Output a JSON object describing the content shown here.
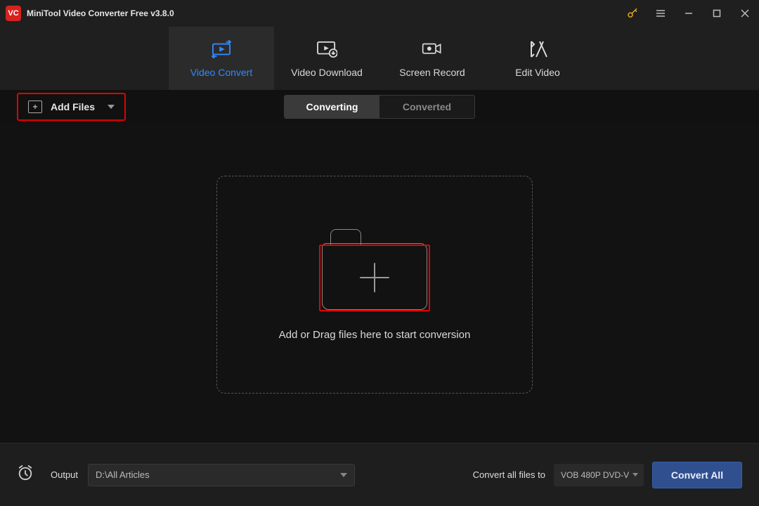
{
  "titlebar": {
    "app_abbrev": "VC",
    "title": "MiniTool Video Converter Free v3.8.0"
  },
  "tabs": {
    "convert": "Video Convert",
    "download": "Video Download",
    "record": "Screen Record",
    "edit": "Edit Video"
  },
  "toolbar": {
    "add_files": "Add Files",
    "seg_converting": "Converting",
    "seg_converted": "Converted"
  },
  "dropzone": {
    "text": "Add or Drag files here to start conversion"
  },
  "bottom": {
    "output_label": "Output",
    "output_path": "D:\\All Articles",
    "convert_all_label": "Convert all files to",
    "format_value": "VOB 480P DVD-V",
    "convert_all_btn": "Convert All"
  }
}
